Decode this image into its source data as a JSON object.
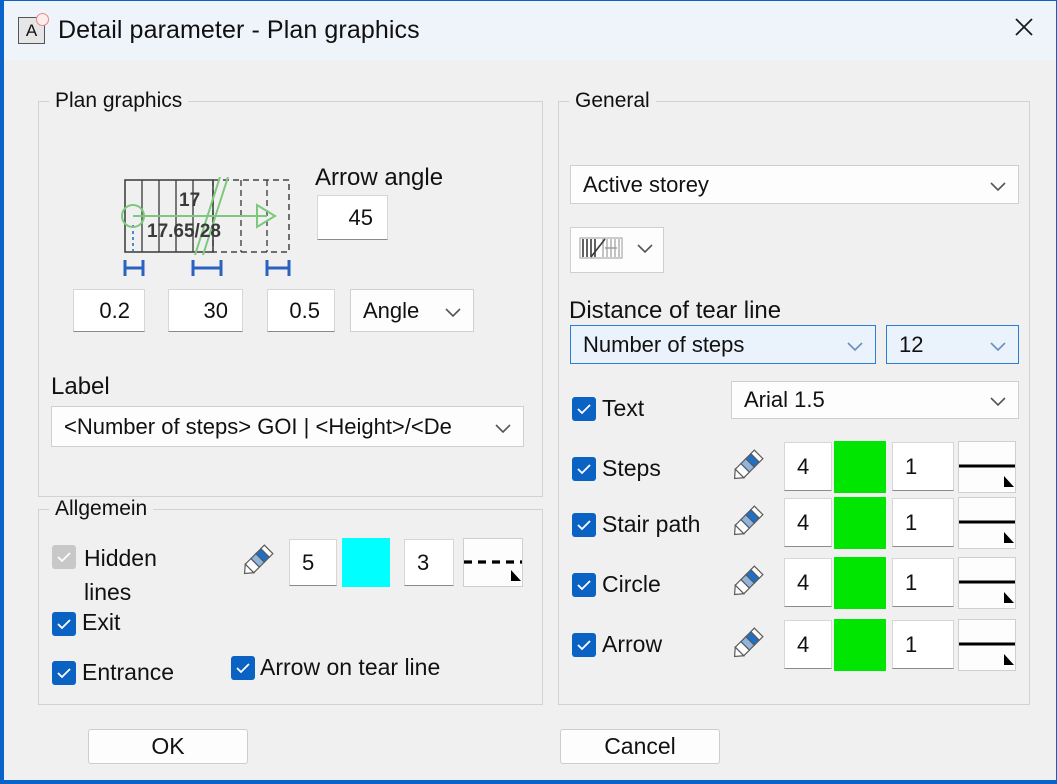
{
  "window": {
    "title": "Detail parameter - Plan graphics",
    "app_icon": "letter-a-icon",
    "close_label": "✕"
  },
  "plan_graphics": {
    "legend": "Plan graphics",
    "arrow_angle_label": "Arrow angle",
    "arrow_angle_value": "45",
    "dim1_value": "0.2",
    "dim2_value": "30",
    "dim3_value": "0.5",
    "mode_value": "Angle",
    "label_legend": "Label",
    "label_value": "<Number of steps> GOI | <Height>/<De",
    "diagram": {
      "top_text": "17",
      "bottom_text": "17.65/28",
      "arrow_color": "#7dc87d",
      "line_color": "#444444"
    }
  },
  "allgemein": {
    "legend": "Allgemein",
    "hidden_lines_label": "Hidden lines",
    "hidden_lines_checked": true,
    "hidden_lines_enabled": false,
    "exit_label": "Exit",
    "exit_checked": true,
    "entrance_label": "Entrance",
    "entrance_checked": true,
    "arrow_on_tear_line_label": "Arrow on tear line",
    "arrow_on_tear_line_checked": true,
    "pen_value": "5",
    "color_value": "#00ffff",
    "stroke_value": "3",
    "line_style": "dashed"
  },
  "general": {
    "legend": "General",
    "storey_value": "Active storey",
    "hatch_value": "hatch-pattern-icon",
    "tear_line_label": "Distance of tear line",
    "tear_line_mode": "Number of steps",
    "tear_line_count": "12",
    "text_label": "Text",
    "text_checked": true,
    "font_value": "Arial 1.5",
    "rows": [
      {
        "label": "Steps",
        "checked": true,
        "pen": "4",
        "color": "#00e600",
        "stroke": "1",
        "line_style": "solid"
      },
      {
        "label": "Stair path",
        "checked": true,
        "pen": "4",
        "color": "#00e600",
        "stroke": "1",
        "line_style": "solid"
      },
      {
        "label": "Circle",
        "checked": true,
        "pen": "4",
        "color": "#00e600",
        "stroke": "1",
        "line_style": "solid"
      },
      {
        "label": "Arrow",
        "checked": true,
        "pen": "4",
        "color": "#00e600",
        "stroke": "1",
        "line_style": "solid"
      }
    ]
  },
  "footer": {
    "ok_label": "OK",
    "cancel_label": "Cancel"
  }
}
